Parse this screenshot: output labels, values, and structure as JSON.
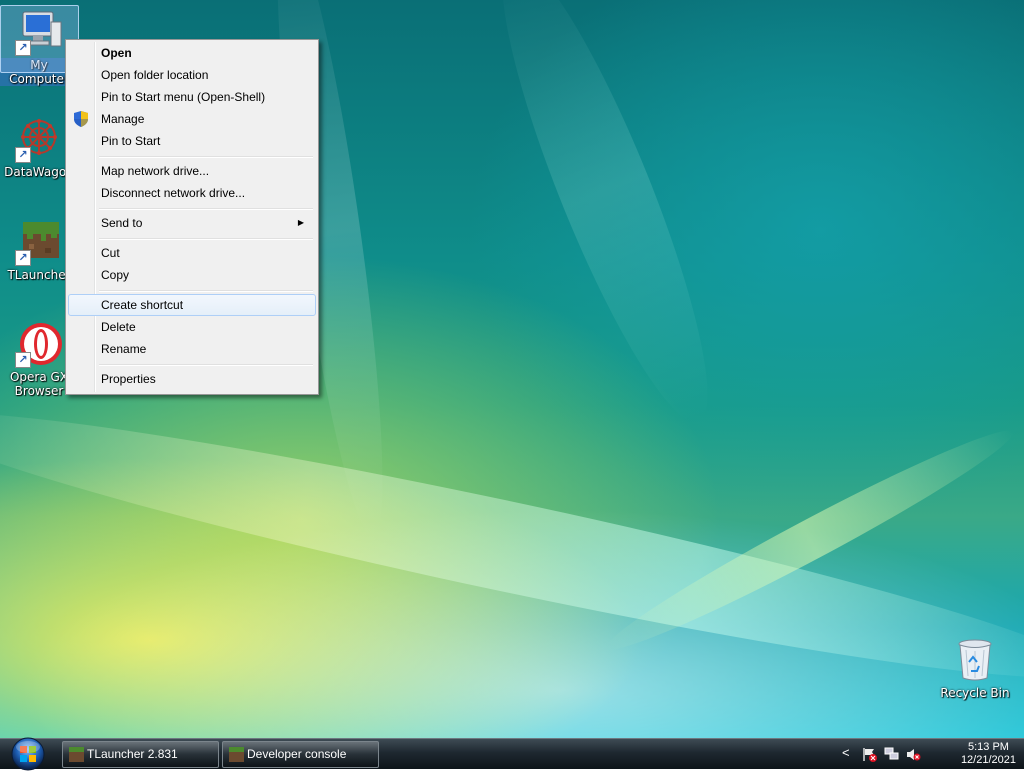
{
  "desktop": {
    "icons": [
      {
        "label": "My Computer",
        "name": "my-computer"
      },
      {
        "label": "DataWagon",
        "name": "datawagon"
      },
      {
        "label": "TLauncher",
        "name": "tlauncher"
      },
      {
        "label": "Opera GX Browser",
        "name": "opera-gx"
      },
      {
        "label": "Recycle Bin",
        "name": "recycle-bin"
      }
    ]
  },
  "context_menu": {
    "items": [
      {
        "label": "Open",
        "bold": true
      },
      {
        "label": "Open folder location"
      },
      {
        "label": "Pin to Start menu (Open-Shell)"
      },
      {
        "label": "Manage",
        "icon": "uac-shield-icon"
      },
      {
        "label": "Pin to Start"
      },
      {
        "label": "Map network drive..."
      },
      {
        "label": "Disconnect network drive..."
      },
      {
        "label": "Send to",
        "submenu": true
      },
      {
        "label": "Cut"
      },
      {
        "label": "Copy"
      },
      {
        "label": "Create shortcut",
        "highlighted": true
      },
      {
        "label": "Delete"
      },
      {
        "label": "Rename"
      },
      {
        "label": "Properties"
      }
    ]
  },
  "taskbar": {
    "tasks": [
      {
        "label": "TLauncher 2.831"
      },
      {
        "label": "Developer console"
      }
    ],
    "tray": {
      "chevron": "<",
      "time": "5:13 PM",
      "date": "12/21/2021"
    }
  },
  "colors": {
    "menu_bg": "#f0f0f0",
    "highlight_border": "#aecff7",
    "taskbar": "#1e2830"
  }
}
